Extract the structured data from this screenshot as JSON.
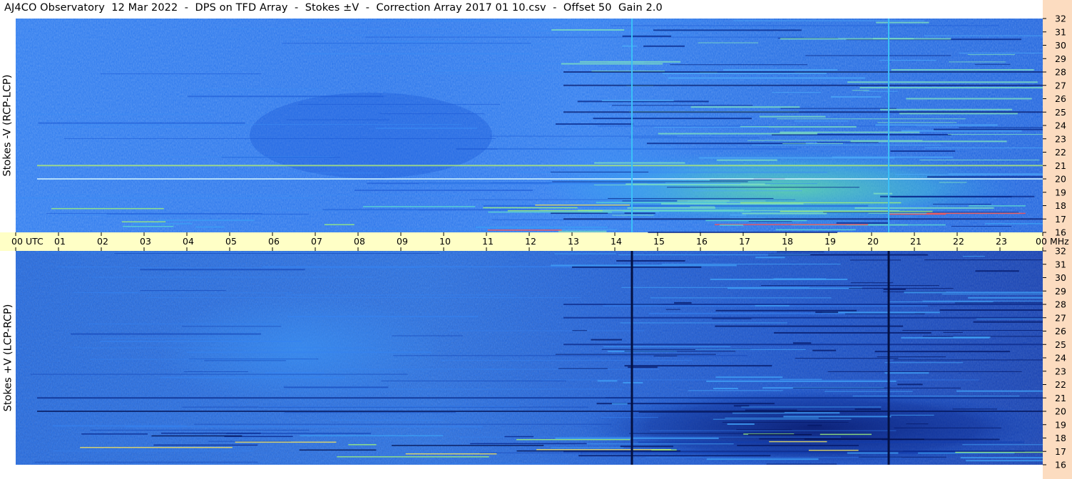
{
  "title": "AJ4CO Observatory  12 Mar 2022  -  DPS on TFD Array  -  Stokes ±V  -  Correction Array 2017 01 10.csv  -  Offset 50  Gain 2.0",
  "panels": [
    {
      "ylabel": "Stokes -V (RCP-LCP)"
    },
    {
      "ylabel": "Stokes +V (LCP-RCP)"
    }
  ],
  "colors": {
    "time_band": "#ffffc6",
    "freq_strip": "#fcdcc0",
    "background_blue": "#1f6ee8",
    "spectrogram_top_base": "#2272ec",
    "spectrogram_bottom_base": "#1c63e0"
  },
  "chart_data": {
    "type": "heatmap",
    "x_ticks": [
      "00",
      "01",
      "02",
      "03",
      "04",
      "05",
      "06",
      "07",
      "08",
      "09",
      "10",
      "11",
      "12",
      "13",
      "14",
      "15",
      "16",
      "17",
      "18",
      "19",
      "20",
      "21",
      "22",
      "23",
      "00"
    ],
    "x_unit": "UTC",
    "y_ticks": [
      "32",
      "31",
      "30",
      "29",
      "28",
      "27",
      "26",
      "25",
      "24",
      "23",
      "22",
      "21",
      "20",
      "19",
      "18",
      "17",
      "16"
    ],
    "y_unit": "MHz",
    "xlim_hours": [
      0,
      24
    ],
    "ylim_mhz": [
      16,
      32
    ],
    "vertical_lines_utc": [
      14.4,
      20.4
    ],
    "persistent_bands_mhz": [
      20.0,
      21.0,
      25.0,
      17.0,
      27.0,
      28.0
    ]
  }
}
